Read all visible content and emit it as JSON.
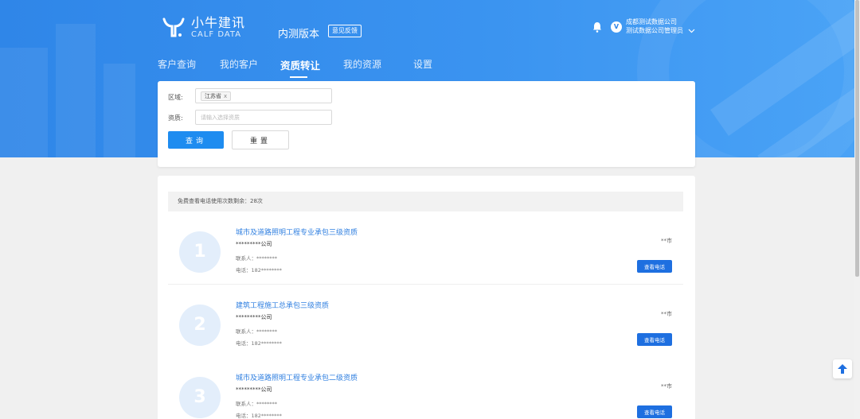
{
  "brand": {
    "name_cn": "小牛建讯",
    "name_en": "CALF DATA"
  },
  "header": {
    "version_label": "内测版本",
    "feedback_label": "意见反馈",
    "user_company": "成都测试数据公司",
    "user_role": "测试数据公司管理员",
    "avatar_letter": "V"
  },
  "nav": {
    "items": [
      {
        "label": "客户查询"
      },
      {
        "label": "我的客户"
      },
      {
        "label": "资质转让",
        "active": true
      },
      {
        "label": "我的资源"
      },
      {
        "label": "设置"
      }
    ]
  },
  "filter": {
    "region_label": "区域:",
    "region_tag": "江苏省",
    "region_tag_remove": "x",
    "qualification_label": "资质:",
    "qualification_placeholder": "请输入选择资质",
    "search_label": "查询",
    "reset_label": "重置"
  },
  "results": {
    "quota_text": "免费查看电话使用次数剩余：28次",
    "items": [
      {
        "index": "1",
        "title": "城市及道路照明工程专业承包三级资质",
        "company": "*********公司",
        "contact": "联系人：********",
        "phone": "电话：182********",
        "city": "**市",
        "button": "查看电话"
      },
      {
        "index": "2",
        "title": "建筑工程施工总承包三级资质",
        "company": "*********公司",
        "contact": "联系人：********",
        "phone": "电话：182********",
        "city": "**市",
        "button": "查看电话"
      },
      {
        "index": "3",
        "title": "城市及道路照明工程专业承包二级资质",
        "company": "*********公司",
        "contact": "联系人：********",
        "phone": "电话：182********",
        "city": "**市",
        "button": "查看电话"
      }
    ]
  },
  "colors": {
    "primary": "#1e8cf0",
    "hero": "#3a93f0",
    "link": "#2f7fe0"
  }
}
